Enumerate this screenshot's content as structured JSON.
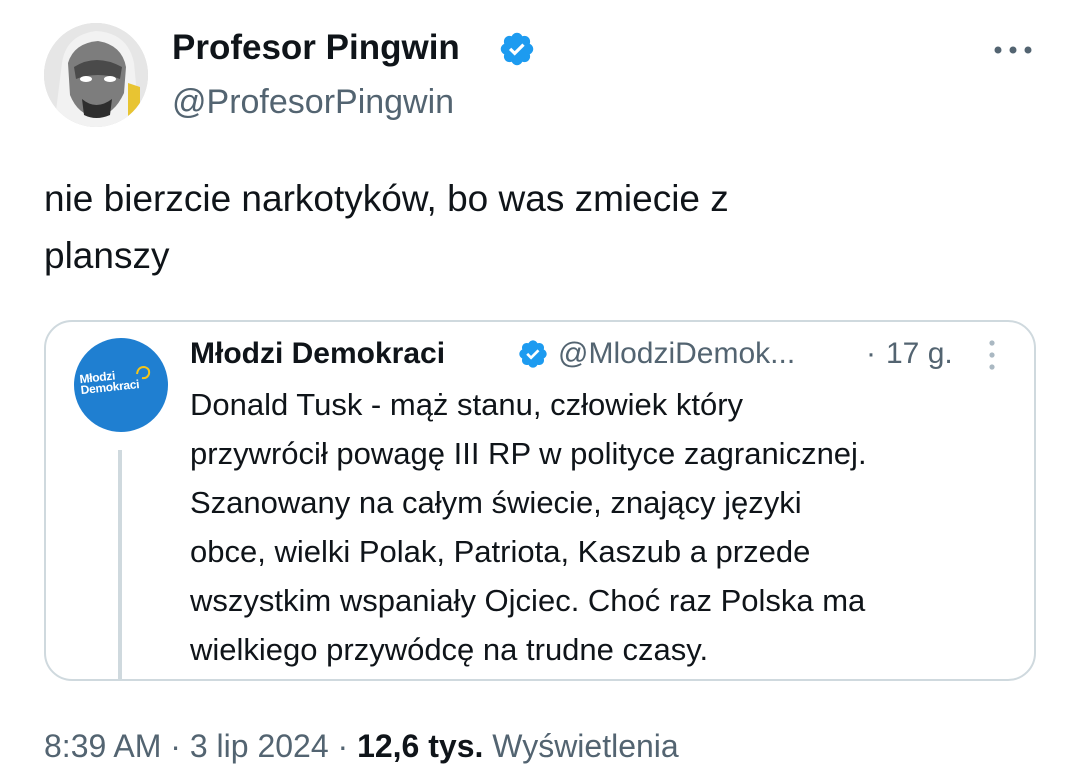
{
  "author": {
    "name": "Profesor Pingwin",
    "handle": "@ProfesorPingwin",
    "verified": true
  },
  "tweet": {
    "text": "nie bierzcie narkotyków, bo was zmiecie z\nplanszy"
  },
  "quoted": {
    "name": "Młodzi Demokraci",
    "handle": "@MlodziDemok...",
    "separator": "·",
    "time": "17 g.",
    "verified": true,
    "avatar_text": "Młodzi\nDemokraci",
    "text": "Donald Tusk - mąż stanu, człowiek który\nprzywrócił powagę III RP w polityce zagranicznej.\nSzanowany na całym świecie, znający języki\nobce, wielki Polak, Patriota, Kaszub a przede\nwszystkim wspaniały Ojciec. Choć raz Polska ma\nwielkiego przywódcę na trudne czasy."
  },
  "meta": {
    "time": "8:39 AM",
    "sep1": " · ",
    "date": "3 lip 2024",
    "sep2": " · ",
    "views_count": "12,6 tys.",
    "views_label": " Wyświetlenia"
  },
  "colors": {
    "verified_blue": "#1d9bf0",
    "secondary_text": "#536471",
    "primary_text": "#0f1419",
    "border": "#cfd9de",
    "quoted_avatar_bg": "#1f7fd1"
  },
  "icons": {
    "verified": "verified-badge-icon",
    "more": "more-horizontal-icon",
    "quoted_more": "more-vertical-icon"
  }
}
